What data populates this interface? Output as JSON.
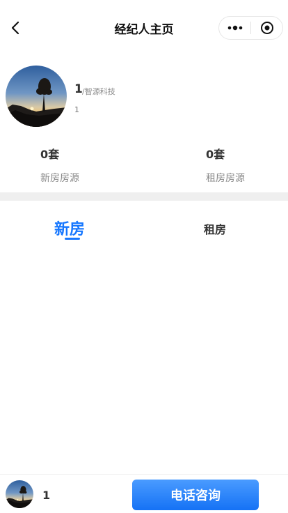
{
  "nav": {
    "title": "经纪人主页",
    "back_icon": "chevron-left-icon",
    "menu_icon": "more-dots-icon",
    "close_icon": "target-circle-icon"
  },
  "agent": {
    "name": "1",
    "company": "/智源科技",
    "subtitle": "1",
    "avatar": "sunset-tree-photo"
  },
  "stats": [
    {
      "count": "0套",
      "label": "新房房源"
    },
    {
      "count": "0套",
      "label": "租房房源"
    }
  ],
  "tabs": [
    {
      "label": "新房",
      "active": true
    },
    {
      "label": "租房",
      "active": false
    }
  ],
  "bottom": {
    "name": "1",
    "call_label": "电话咨询"
  },
  "colors": {
    "accent": "#1677ff",
    "divider_band": "#efefef"
  }
}
